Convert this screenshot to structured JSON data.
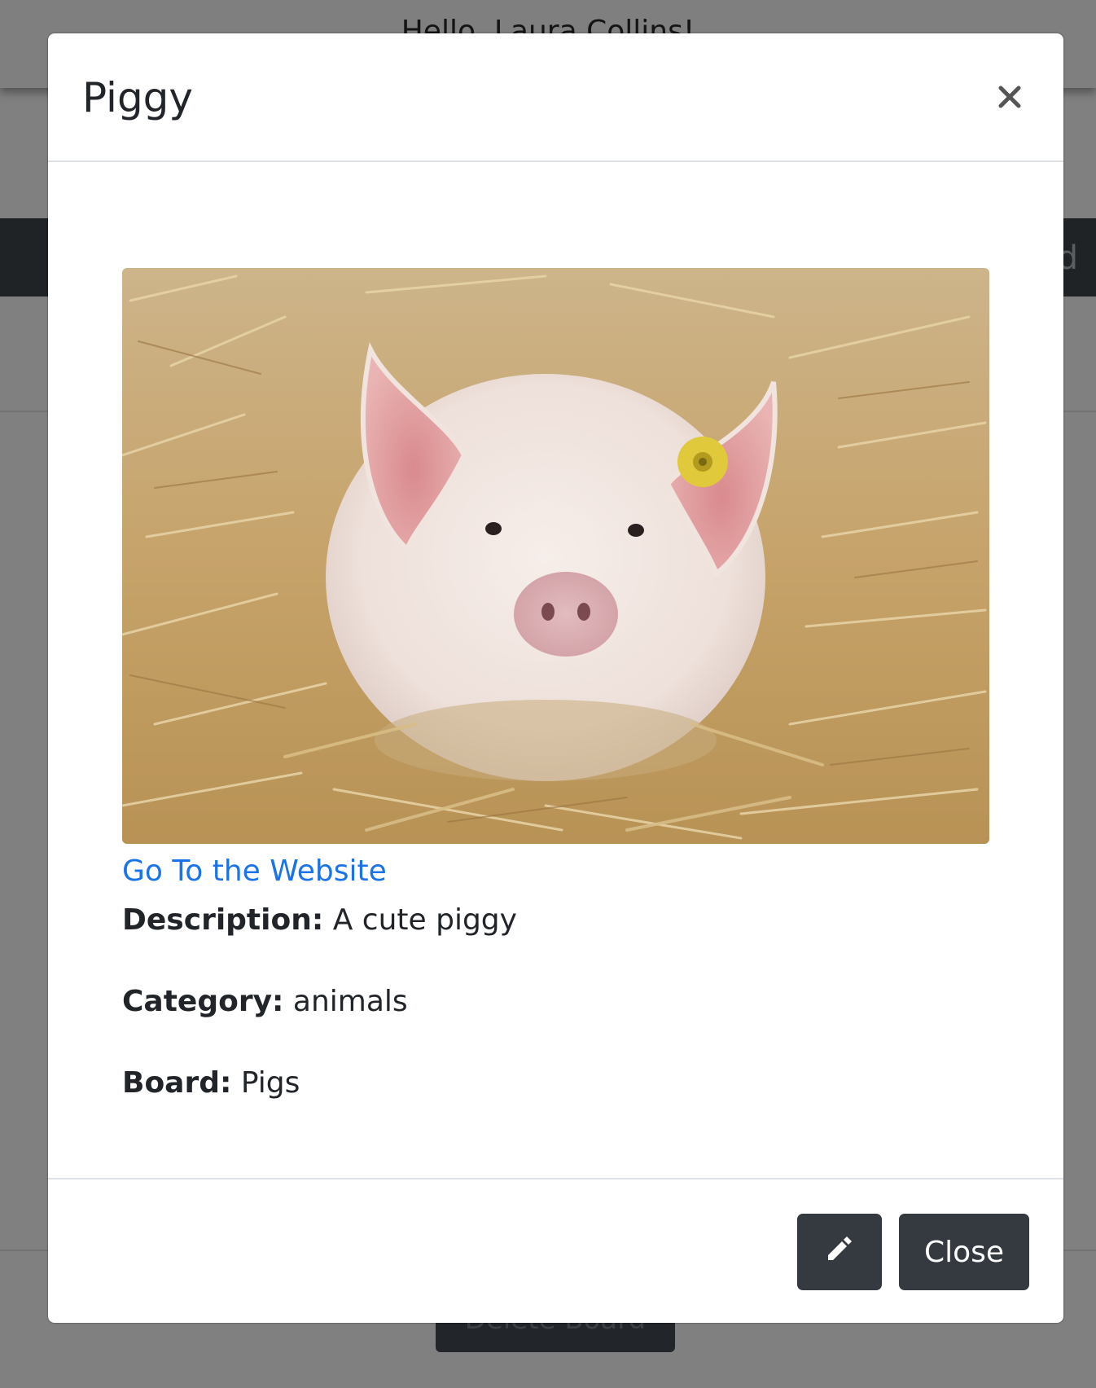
{
  "background": {
    "greeting": "Hello, Laura Collins!",
    "navbar_fragment": "d",
    "delete_button_label": "Delete Board"
  },
  "modal": {
    "title": "Piggy",
    "close_icon": "close-x-icon",
    "image_alt": "A white piglet lying in straw with a yellow ear tag",
    "link_text": "Go To the Website",
    "details": {
      "description_label": "Description:",
      "description_value": "A cute piggy",
      "category_label": "Category:",
      "category_value": "animals",
      "board_label": "Board:",
      "board_value": "Pigs"
    },
    "footer": {
      "edit_icon": "pencil-icon",
      "close_label": "Close"
    }
  },
  "colors": {
    "link": "#1a73e8",
    "button_dark": "#343a40",
    "overlay": "#808080"
  }
}
